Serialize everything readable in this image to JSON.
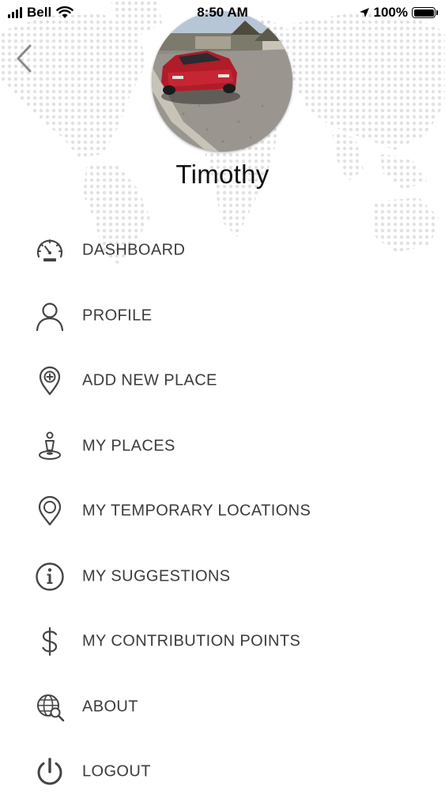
{
  "status_bar": {
    "carrier": "Bell",
    "time": "8:50 AM",
    "battery_percent": "100%",
    "battery_level": 1.0,
    "icons": [
      "cellular-signal-icon",
      "wifi-icon",
      "location-arrow-icon",
      "battery-icon"
    ]
  },
  "header": {
    "back_icon": "chevron-left-icon",
    "user_name": "Timothy",
    "avatar_description": "photo-of-red-car-avatar"
  },
  "menu": {
    "items": [
      {
        "label": "DASHBOARD",
        "icon": "speedometer-icon"
      },
      {
        "label": "PROFILE",
        "icon": "user-icon"
      },
      {
        "label": "ADD NEW PLACE",
        "icon": "map-pin-plus-icon"
      },
      {
        "label": "MY PLACES",
        "icon": "person-pin-icon"
      },
      {
        "label": "MY TEMPORARY LOCATIONS",
        "icon": "map-pin-icon"
      },
      {
        "label": "MY SUGGESTIONS",
        "icon": "info-icon"
      },
      {
        "label": "MY CONTRIBUTION POINTS",
        "icon": "dollar-icon"
      },
      {
        "label": "ABOUT",
        "icon": "globe-search-icon"
      },
      {
        "label": "LOGOUT",
        "icon": "power-icon"
      }
    ]
  },
  "colors": {
    "background": "#ffffff",
    "menu_text": "#3b3b3b",
    "icon_stroke": "#444444",
    "map_dots": "#e2e2e2"
  }
}
